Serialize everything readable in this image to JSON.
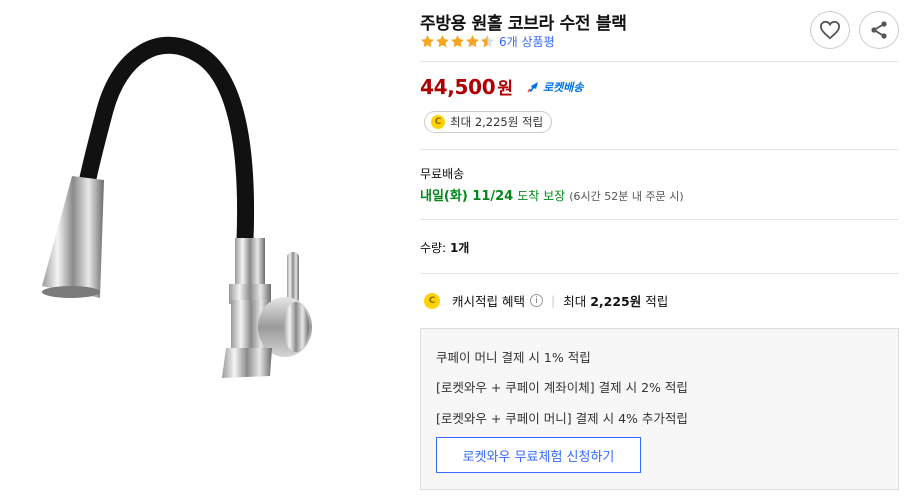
{
  "product": {
    "title": "주방용 원홀 코브라 수전 블랙",
    "rating": 4.5,
    "review_count": "6개 상품평",
    "price": "44,500",
    "price_unit": "원",
    "delivery_badge": "로켓배송",
    "cash_pill": "최대 2,225원 적립"
  },
  "shipping": {
    "label": "무료배송",
    "arrival_date": "내일(화) 11/24",
    "arrival_guarantee": "도착 보장",
    "arrival_note": "(6시간 52분 내 주문 시)"
  },
  "quantity": {
    "label": "수량:",
    "value": "1개"
  },
  "benefit": {
    "title": "캐시적립 혜택",
    "max_prefix": "최대",
    "max_amount": "2,225원",
    "max_suffix": "적립",
    "lines": [
      "쿠페이 머니 결제 시 1% 적립",
      "[로켓와우 + 쿠페이 계좌이체] 결제 시 2% 적립",
      "[로켓와우 + 쿠페이 머니] 결제 시 4% 추가적립"
    ],
    "trial_button": "로켓와우 무료체험 신청하기"
  },
  "icons": {
    "heart": "heart-icon",
    "share": "share-icon",
    "coin": "C",
    "info": "i"
  },
  "colors": {
    "price": "#ae0000",
    "link": "#346aff",
    "arrival": "#00891a",
    "star": "#f5a623",
    "coin": "#ffd200"
  }
}
